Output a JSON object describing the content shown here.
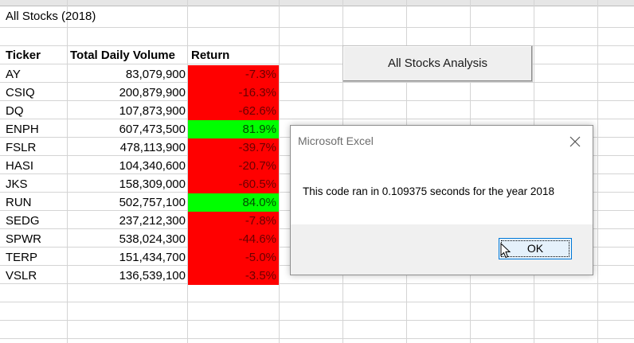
{
  "sheet": {
    "title": "All Stocks (2018)",
    "headers": {
      "ticker": "Ticker",
      "volume": "Total Daily Volume",
      "return": "Return"
    },
    "rows": [
      {
        "ticker": "AY",
        "volume": "83,079,900",
        "return": "-7.3%",
        "positive": false
      },
      {
        "ticker": "CSIQ",
        "volume": "200,879,900",
        "return": "-16.3%",
        "positive": false
      },
      {
        "ticker": "DQ",
        "volume": "107,873,900",
        "return": "-62.6%",
        "positive": false
      },
      {
        "ticker": "ENPH",
        "volume": "607,473,500",
        "return": "81.9%",
        "positive": true
      },
      {
        "ticker": "FSLR",
        "volume": "478,113,900",
        "return": "-39.7%",
        "positive": false
      },
      {
        "ticker": "HASI",
        "volume": "104,340,600",
        "return": "-20.7%",
        "positive": false
      },
      {
        "ticker": "JKS",
        "volume": "158,309,000",
        "return": "-60.5%",
        "positive": false
      },
      {
        "ticker": "RUN",
        "volume": "502,757,100",
        "return": "84.0%",
        "positive": true
      },
      {
        "ticker": "SEDG",
        "volume": "237,212,300",
        "return": "-7.8%",
        "positive": false
      },
      {
        "ticker": "SPWR",
        "volume": "538,024,300",
        "return": "-44.6%",
        "positive": false
      },
      {
        "ticker": "TERP",
        "volume": "151,434,700",
        "return": "-5.0%",
        "positive": false
      },
      {
        "ticker": "VSLR",
        "volume": "136,539,100",
        "return": "-3.5%",
        "positive": false
      }
    ]
  },
  "analysis_button": {
    "label": "All Stocks Analysis"
  },
  "dialog": {
    "title": "Microsoft Excel",
    "message": "This code ran in 0.109375 seconds for the year 2018",
    "ok_label": "OK"
  },
  "colors": {
    "negative_fill": "#ff0000",
    "positive_fill": "#00ff00",
    "ok_button_border": "#0078d7"
  }
}
